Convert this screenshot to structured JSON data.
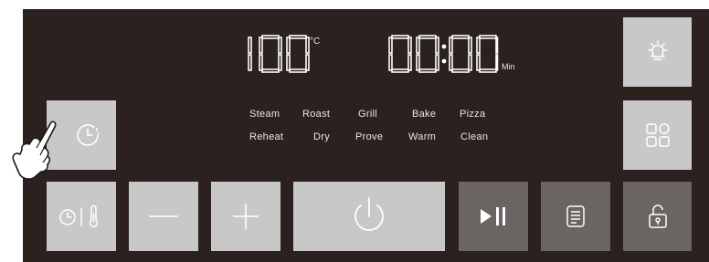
{
  "display": {
    "temperature": "100",
    "temperature_unit": "°C",
    "time": "00:00",
    "time_unit": "Min"
  },
  "modes": {
    "row1": [
      "Steam",
      "Roast",
      "Grill",
      "Bake",
      "Pizza"
    ],
    "row2": [
      "Reheat",
      "Dry",
      "Prove",
      "Warm",
      "Clean"
    ]
  },
  "icons": {
    "light": "lightbulb-icon",
    "menu": "grid-icon",
    "timer": "clock-icon",
    "timer_temp": "clock-thermometer-icon",
    "minus": "minus-icon",
    "plus": "plus-icon",
    "power": "power-icon",
    "start_pause": "play-pause-icon",
    "recipes": "recipe-list-icon",
    "lock": "lock-icon",
    "hand": "hand-pointer-icon"
  },
  "colors": {
    "panel": "#2b211e",
    "light_button": "#c8c8c8",
    "dark_button": "#6a6462",
    "segment": "#ffffff"
  }
}
